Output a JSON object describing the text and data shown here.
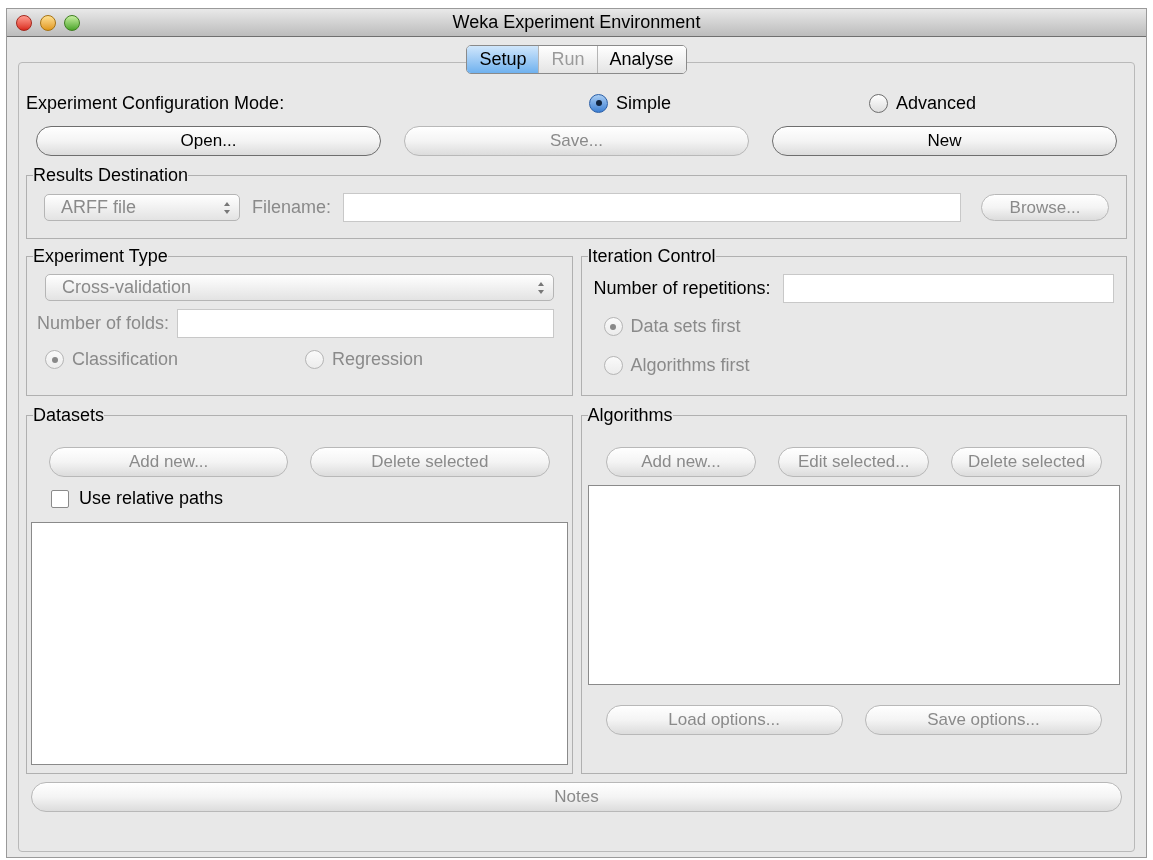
{
  "window": {
    "title": "Weka Experiment Environment"
  },
  "tabs": [
    {
      "label": "Setup",
      "selected": true,
      "disabled": false
    },
    {
      "label": "Run",
      "selected": false,
      "disabled": true
    },
    {
      "label": "Analyse",
      "selected": false,
      "disabled": false
    }
  ],
  "config_mode": {
    "label": "Experiment Configuration Mode:",
    "options": [
      {
        "label": "Simple",
        "selected": true,
        "disabled": false
      },
      {
        "label": "Advanced",
        "selected": false,
        "disabled": false
      }
    ]
  },
  "file_buttons": [
    {
      "label": "Open...",
      "disabled": false
    },
    {
      "label": "Save...",
      "disabled": true
    },
    {
      "label": "New",
      "disabled": false
    }
  ],
  "results_destination": {
    "title": "Results Destination",
    "type_select": {
      "value": "ARFF file",
      "disabled": true
    },
    "filename_label": "Filename:",
    "browse_button": {
      "label": "Browse...",
      "disabled": true
    }
  },
  "experiment_type": {
    "title": "Experiment Type",
    "type_select": {
      "value": "Cross-validation",
      "disabled": true
    },
    "folds_label": "Number of folds:",
    "folds_disabled": true,
    "options": [
      {
        "label": "Classification",
        "selected": true,
        "disabled": true
      },
      {
        "label": "Regression",
        "selected": false,
        "disabled": true
      }
    ]
  },
  "iteration_control": {
    "title": "Iteration Control",
    "repetitions_label": "Number of repetitions:",
    "options": [
      {
        "label": "Data sets first",
        "selected": true,
        "disabled": true
      },
      {
        "label": "Algorithms first",
        "selected": false,
        "disabled": true
      }
    ]
  },
  "datasets": {
    "title": "Datasets",
    "buttons": [
      {
        "label": "Add new...",
        "disabled": true
      },
      {
        "label": "Delete selected",
        "disabled": true
      }
    ],
    "relative_paths": {
      "label": "Use relative paths",
      "checked": false
    }
  },
  "algorithms": {
    "title": "Algorithms",
    "buttons": [
      {
        "label": "Add new...",
        "disabled": true
      },
      {
        "label": "Edit selected...",
        "disabled": true
      },
      {
        "label": "Delete selected",
        "disabled": true
      }
    ],
    "option_buttons": [
      {
        "label": "Load options...",
        "disabled": true
      },
      {
        "label": "Save options...",
        "disabled": true
      }
    ]
  },
  "notes_button": {
    "label": "Notes",
    "disabled": true
  }
}
